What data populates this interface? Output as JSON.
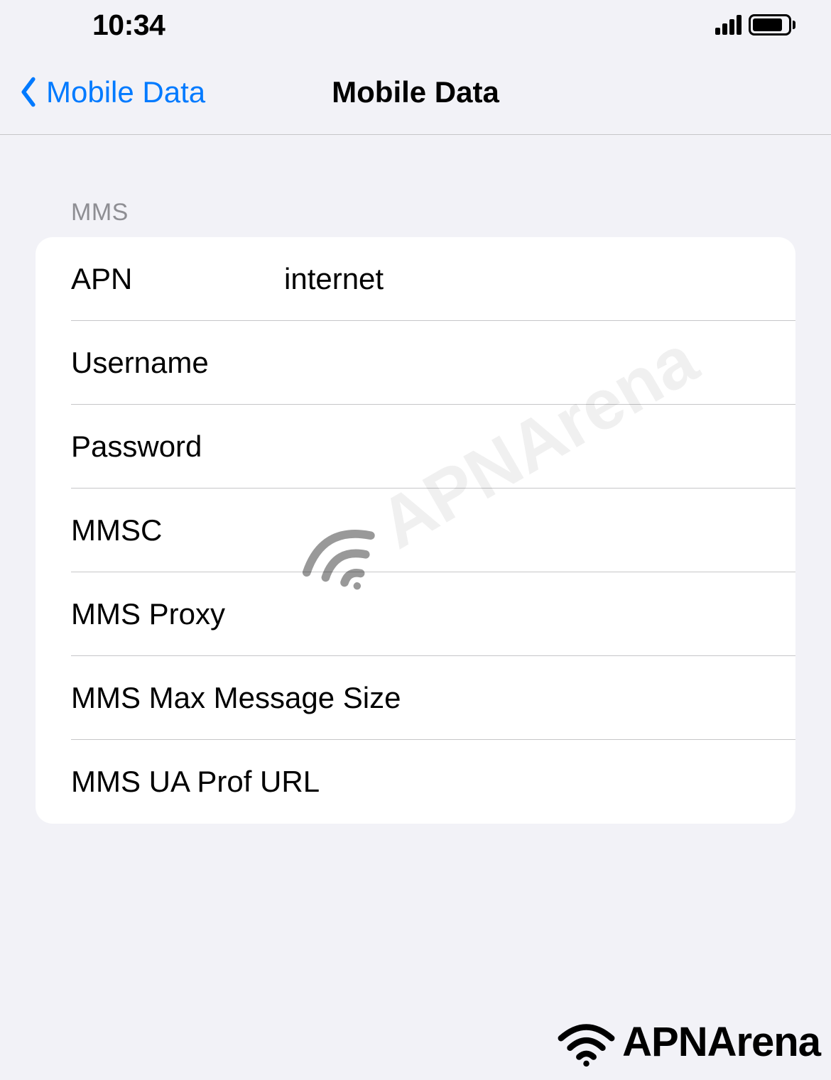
{
  "statusBar": {
    "time": "10:34"
  },
  "nav": {
    "backLabel": "Mobile Data",
    "title": "Mobile Data"
  },
  "section": {
    "header": "MMS",
    "rows": [
      {
        "label": "APN",
        "value": "internet"
      },
      {
        "label": "Username",
        "value": ""
      },
      {
        "label": "Password",
        "value": ""
      },
      {
        "label": "MMSC",
        "value": ""
      },
      {
        "label": "MMS Proxy",
        "value": ""
      },
      {
        "label": "MMS Max Message Size",
        "value": ""
      },
      {
        "label": "MMS UA Prof URL",
        "value": ""
      }
    ]
  },
  "watermark": "APNArena",
  "footerBrand": "APNArena"
}
